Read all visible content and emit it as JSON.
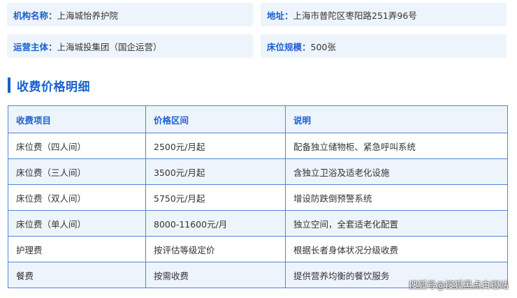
{
  "info": [
    {
      "label": "机构名称：",
      "value": "上海城怡养护院"
    },
    {
      "label": "地址：",
      "value": "上海市普陀区枣阳路251弄96号"
    },
    {
      "label": "运营主体：",
      "value": "上海城投集团（国企运营）"
    },
    {
      "label": "床位规模：",
      "value": "500张"
    }
  ],
  "section_title": "收费价格明细",
  "table": {
    "headers": [
      "收费项目",
      "价格区间",
      "说明"
    ],
    "rows": [
      [
        "床位费（四人间）",
        "2500元/月起",
        "配备独立储物柜、紧急呼叫系统"
      ],
      [
        "床位费（三人间）",
        "3500元/月起",
        "含独立卫浴及适老化设施"
      ],
      [
        "床位费（双人间）",
        "5750元/月起",
        "增设防跌倒预警系统"
      ],
      [
        "床位费（单人间）",
        "8000-11600元/月",
        "独立空间，全套适老化配置"
      ],
      [
        "护理费",
        "按评估等级定价",
        "根据长者身体状况分级收费"
      ],
      [
        "餐费",
        "按需收费",
        "提供营养均衡的餐饮服务"
      ]
    ]
  },
  "watermark": "搜狐号@搜狐黑点白银站",
  "colors": {
    "accent": "#1a5fd0",
    "card_bg": "#eef4fb",
    "border": "#4f85d6"
  }
}
